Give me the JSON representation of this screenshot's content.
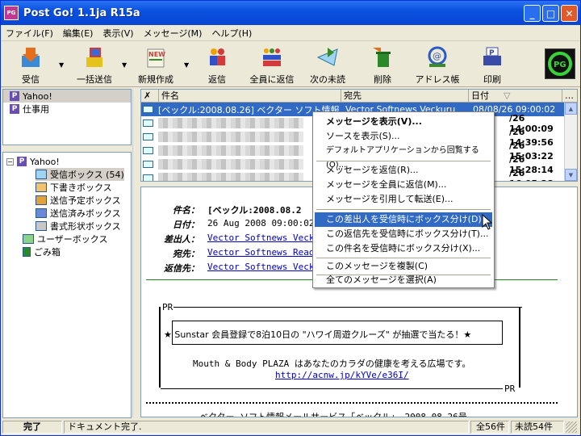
{
  "window": {
    "title": "Post Go! 1.1ja R15a",
    "icon_text": "PostGo"
  },
  "title_buttons": {
    "minimize": "_",
    "maximize": "□",
    "close": "✕"
  },
  "menu": [
    "ファイル(F)",
    "編集(E)",
    "表示(V)",
    "メッセージ(M)",
    "ヘルプ(H)"
  ],
  "toolbar": [
    {
      "label": "受信",
      "icon": "receive-icon",
      "color": "#e66f1c"
    },
    {
      "label": "一括送信",
      "icon": "send-all-icon",
      "color": "#d43a3a"
    },
    {
      "label": "新規作成",
      "icon": "new-icon",
      "color": "#3a8a2a"
    },
    {
      "label": "返信",
      "icon": "reply-icon",
      "color": "#3050c8"
    },
    {
      "label": "全員に返信",
      "icon": "reply-all-icon",
      "color": "#3050c8"
    },
    {
      "label": "次の未読",
      "icon": "next-unread-icon",
      "color": "#2a7a9a"
    },
    {
      "label": "削除",
      "icon": "delete-icon",
      "color": "#2a8a2a"
    },
    {
      "label": "アドレス帳",
      "icon": "address-book-icon",
      "color": "#2a5ac8"
    },
    {
      "label": "印刷",
      "icon": "print-icon",
      "color": "#3a4aa8"
    }
  ],
  "accounts": [
    {
      "label": "Yahoo!"
    },
    {
      "label": "仕事用"
    }
  ],
  "tree": {
    "root": "Yahoo!",
    "folders": [
      {
        "label": "受信ボックス (54)"
      },
      {
        "label": "下書きボックス"
      },
      {
        "label": "送信予定ボックス"
      },
      {
        "label": "送信済みボックス"
      },
      {
        "label": "書式形状ボックス"
      }
    ],
    "user_box": "ユーザーボックス",
    "trash": "ごみ箱"
  },
  "list": {
    "columns": [
      "件名",
      "宛先",
      "日付"
    ],
    "sort_indicator": "▽",
    "rows": [
      {
        "subject": "[ベックル:2008.08.26] ベクター ソフト情報...",
        "to": "Vector Softnews Veckuru",
        "date": "08/08/26 09:00:02"
      },
      {
        "subject": "",
        "to": "",
        "date": "/26 14:00:09"
      },
      {
        "subject": "",
        "to": "",
        "date": "/26 14:39:56"
      },
      {
        "subject": "",
        "to": "",
        "date": "/26 15:03:22"
      },
      {
        "subject": "",
        "to": "",
        "date": "/26 15:28:14"
      },
      {
        "subject": "",
        "to": "",
        "date": "/26 16:05:38"
      }
    ]
  },
  "preview": {
    "headers": [
      {
        "key": "件名：",
        "value": "[ベックル:2008.08.2"
      },
      {
        "key": "日付：",
        "value": "26 Aug 2008 09:00:02 +"
      },
      {
        "key": "差出人：",
        "value": "Vector Softnews Veckur"
      },
      {
        "key": "宛先：",
        "value": "Vector Softnews Reader"
      },
      {
        "key": "返信先：",
        "value": "Vector Softnews Veckur"
      }
    ],
    "pr_top": "PR",
    "pr_bottom": "PR",
    "banner": "★ Sunstar 会員登録で8泊10日の \"ハワイ周遊クルーズ\" が抽選で当たる！★",
    "line2": "Mouth & Body PLAZA はあなたのカラダの健康を考える広場です。",
    "url": "http://acnw.jp/kYVe/e36I/",
    "footer_cut": "ベクター ソフト情報メールサービス「ベックル」 2008.08.26号"
  },
  "context_menu": [
    {
      "label": "メッセージを表示(V)...",
      "bold": true
    },
    {
      "label": "ソースを表示(S)..."
    },
    {
      "label": "デフォルトアプリケーションから回覧する(O)..."
    },
    {
      "label": "メッセージを返信(R)..."
    },
    {
      "label": "メッセージを全員に返信(M)..."
    },
    {
      "label": "メッセージを引用して転送(E)..."
    },
    {
      "label": "この差出人を受信時にボックス分け(D)...",
      "highlight": true
    },
    {
      "label": "この返信先を受信時にボックス分け(T)..."
    },
    {
      "label": "この件名を受信時にボックス分け(X)..."
    },
    {
      "label": "このメッセージを複製(C)"
    },
    {
      "label": "全てのメッセージを選択(A)"
    }
  ],
  "status": {
    "state": "完了",
    "message": "ドキュメント完了.",
    "total": "全56件",
    "unread": "未読54件"
  }
}
